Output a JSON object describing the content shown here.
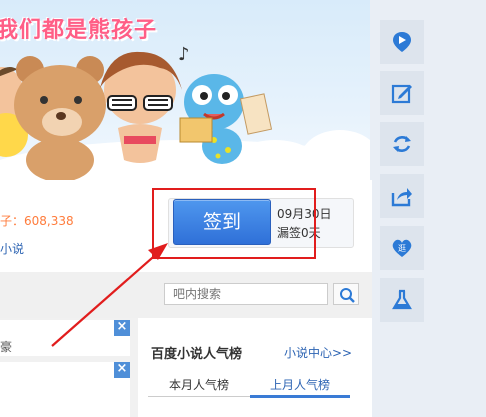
{
  "banner": {
    "title": "我们都是熊孩子"
  },
  "group": {
    "member_count": "子：608,338",
    "novel_link": "小说"
  },
  "sign": {
    "button_label": "签到",
    "date": "09月30日",
    "days": "漏签0天"
  },
  "search": {
    "placeholder": "吧内搜索"
  },
  "rank": {
    "title": "百度小说人气榜",
    "more": "小说中心>>",
    "tabs": [
      {
        "label": "本月人气榜",
        "active": false
      },
      {
        "label": "上月人气榜",
        "active": true
      }
    ]
  },
  "post": {
    "snippet": "豪"
  },
  "tools": [
    "map-pin-icon",
    "edit-icon",
    "refresh-icon",
    "share-icon",
    "heart-icon",
    "flask-icon"
  ],
  "colors": {
    "accent": "#2f70d8",
    "highlight": "#e11d1d",
    "count": "#ff7c3c"
  }
}
